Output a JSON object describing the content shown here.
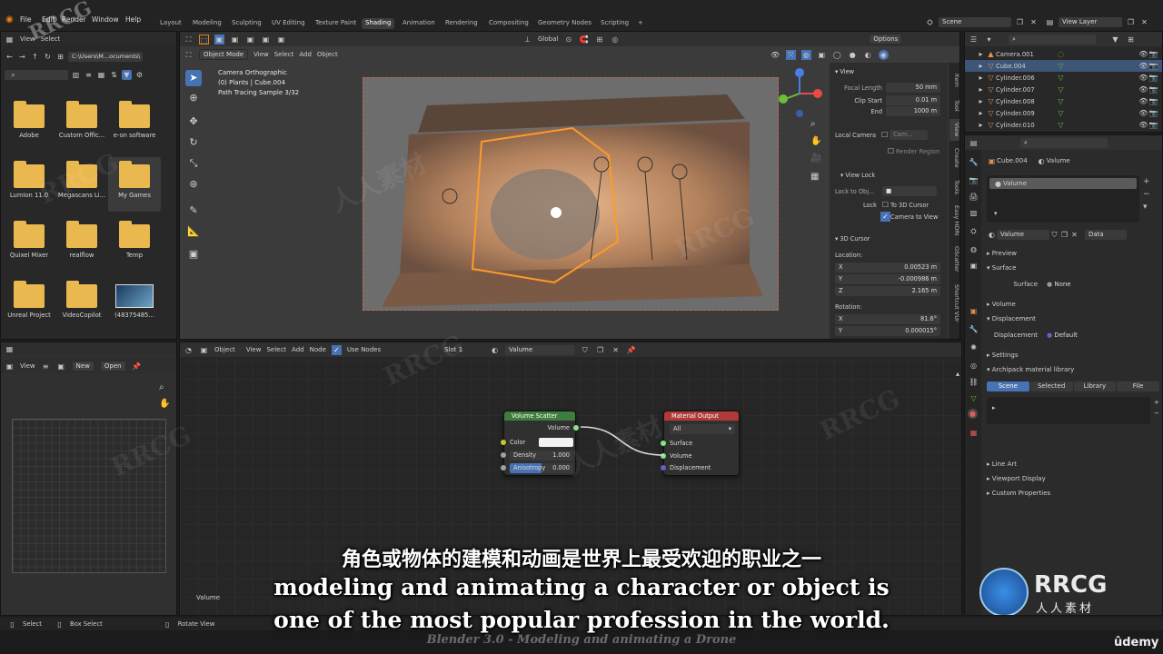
{
  "topbar": {
    "menus": [
      "File",
      "Edit",
      "Render",
      "Window",
      "Help"
    ],
    "workspaces": [
      "Layout",
      "Modeling",
      "Sculpting",
      "UV Editing",
      "Texture Paint",
      "Shading",
      "Animation",
      "Rendering",
      "Compositing",
      "Geometry Nodes",
      "Scripting"
    ],
    "add_tab": "+",
    "scene_label": "Scene",
    "view_layer_label": "View Layer"
  },
  "file_browser": {
    "menus": [
      "View",
      "Select"
    ],
    "path": "C:\\Users\\M...ocuments\\",
    "folders": [
      "Adobe",
      "Custom Offic...",
      "e-on software",
      "Lumion 11.0",
      "Megascans Li...",
      "My Games",
      "Quixel Mixer",
      "realflow",
      "Temp",
      "Unreal Project",
      "VideoCopilot",
      "(48375485..."
    ]
  },
  "viewport": {
    "mode": "Object Mode",
    "menus": [
      "View",
      "Select",
      "Add",
      "Object"
    ],
    "transform": "Global",
    "options": "Options",
    "info_line1": "Camera Orthographic",
    "info_line2": "(0) Plants | Cube.004",
    "info_line3": "Path Tracing Sample 3/32"
  },
  "npanel": {
    "view_header": "View",
    "focal_length_label": "Focal Length",
    "focal_length": "50 mm",
    "clip_start_label": "Clip Start",
    "clip_start": "0.01 m",
    "end_label": "End",
    "end": "1000 m",
    "local_camera_label": "Local Camera",
    "local_camera_value": "Cam...",
    "render_region": "Render Region",
    "view_lock_header": "View Lock",
    "lock_to_object_label": "Lock to Obj...",
    "lock_label": "Lock",
    "to_3d_cursor": "To 3D Cursor",
    "camera_to_view": "Camera to View",
    "cursor_header": "3D Cursor",
    "location_label": "Location:",
    "x_label": "X",
    "x": "0.00523 m",
    "y_label": "Y",
    "y": "-0.000986 m",
    "z_label": "Z",
    "z": "2.165 m",
    "rotation_label": "Rotation:",
    "rx": "81.6°",
    "ry": "0.000015°",
    "tabs": [
      "Item",
      "Tool",
      "View",
      "Create",
      "Tools",
      "Easy HDRI",
      "GScatter",
      "Shortcut VUr"
    ]
  },
  "node_editor": {
    "object_label": "Object",
    "menus": [
      "View",
      "Select",
      "Add",
      "Node"
    ],
    "use_nodes": "Use Nodes",
    "slot": "Slot 1",
    "material": "Valume",
    "footer_label": "Valume",
    "volume_scatter": {
      "title": "Volume Scatter",
      "output": "Volume",
      "color": "Color",
      "density_label": "Density",
      "density": "1.000",
      "anisotropy_label": "Anisotropy",
      "anisotropy": "0.000"
    },
    "material_output": {
      "title": "Material Output",
      "target": "All",
      "inputs": [
        "Surface",
        "Volume",
        "Displacement"
      ]
    }
  },
  "image_editor": {
    "view": "View",
    "new": "New",
    "open": "Open"
  },
  "outliner": {
    "items": [
      {
        "name": "Camera.001",
        "selected": false
      },
      {
        "name": "Cube.004",
        "selected": true
      },
      {
        "name": "Cylinder.006",
        "selected": false
      },
      {
        "name": "Cylinder.007",
        "selected": false
      },
      {
        "name": "Cylinder.008",
        "selected": false
      },
      {
        "name": "Cylinder.009",
        "selected": false
      },
      {
        "name": "Cylinder.010",
        "selected": false
      }
    ]
  },
  "properties": {
    "object": "Cube.004",
    "material": "Valume",
    "slot_item": "Valume",
    "mat_field": "Valume",
    "data": "Data",
    "preview": "Preview",
    "surface_header": "Surface",
    "surface_label": "Surface",
    "surface_value": "None",
    "volume": "Volume",
    "displacement_header": "Displacement",
    "displacement_label": "Displacement",
    "displacement_value": "Default",
    "settings": "Settings",
    "archipack": "Archipack material library",
    "lib_tabs": [
      "Scene",
      "Selected",
      "Library",
      "File"
    ],
    "line_art": "Line Art",
    "viewport_display": "Viewport Display",
    "custom_properties": "Custom Properties"
  },
  "statusbar": {
    "select": "Select",
    "box_select": "Box Select",
    "rotate_view": "Rotate View"
  },
  "subtitles": {
    "chinese": "角色或物体的建模和动画是世界上最受欢迎的职业之一",
    "english_line1": "modeling and animating a character or object is",
    "english_line2": "one of the most popular profession in the world.",
    "course_title": "Blender 3.0 - Modeling and animating a Drone",
    "udemy": "ûdemy"
  },
  "watermarks": {
    "rrcg": "RRCG",
    "cn": "人人素材"
  }
}
